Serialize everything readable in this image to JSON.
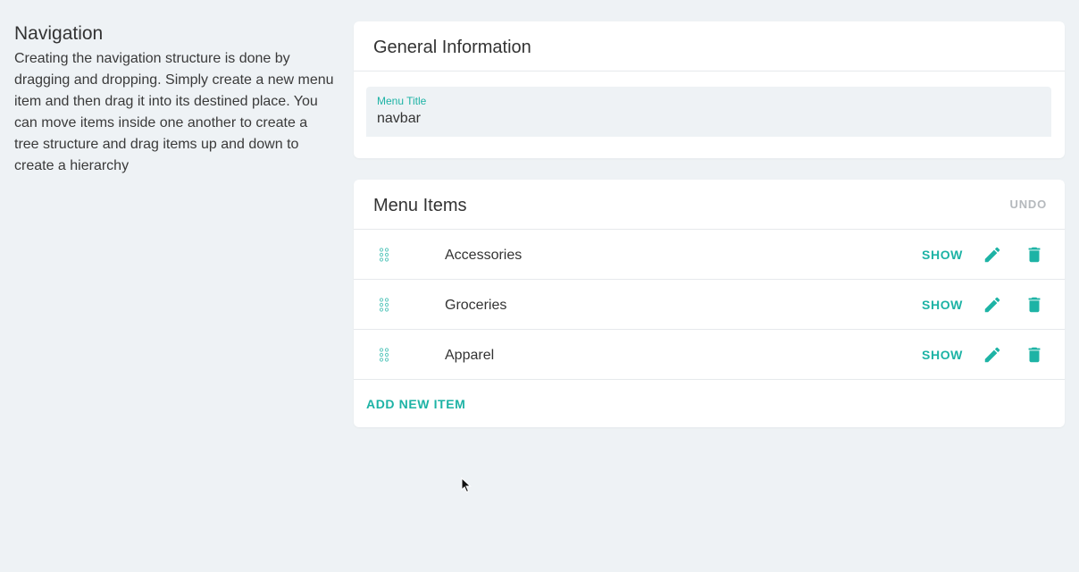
{
  "navigation": {
    "title": "Navigation",
    "description": "Creating the navigation structure is done by dragging and dropping. Simply create a new menu item and then drag it into its destined place. You can move items inside one another to create a tree structure and drag items up and down to create a hierarchy"
  },
  "general_info": {
    "title": "General Information",
    "menu_title_label": "Menu Title",
    "menu_title_value": "navbar"
  },
  "menu_items": {
    "title": "Menu Items",
    "undo_label": "UNDO",
    "show_label": "SHOW",
    "add_label": "ADD NEW ITEM",
    "items": [
      {
        "label": "Accessories"
      },
      {
        "label": "Groceries"
      },
      {
        "label": "Apparel"
      }
    ]
  },
  "icons": {
    "drag": "drag-handle-icon",
    "edit": "pencil-icon",
    "delete": "trash-icon"
  },
  "colors": {
    "accent": "#1db3a5",
    "background": "#eef2f5",
    "muted": "#b5b9bd"
  }
}
